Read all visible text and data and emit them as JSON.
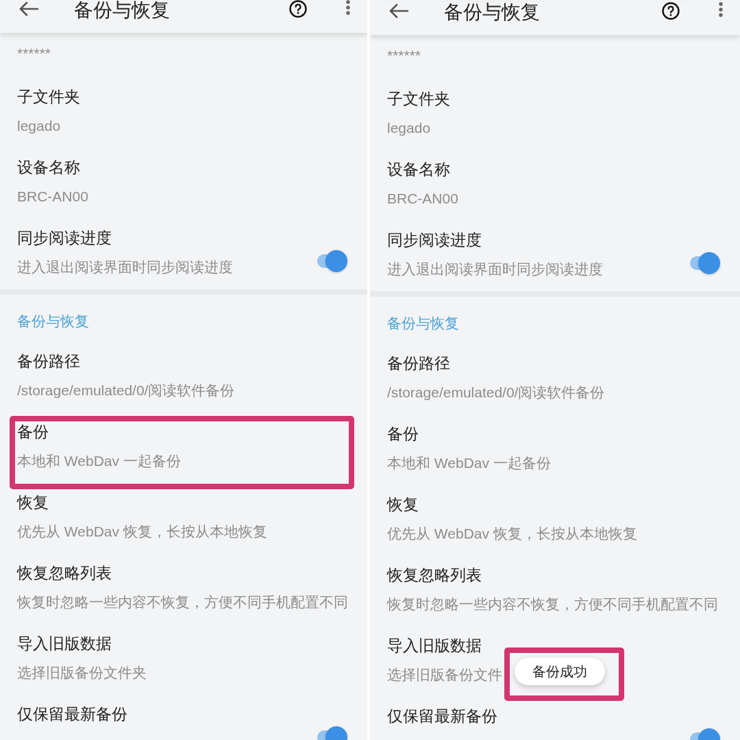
{
  "panels": [
    {
      "app_bar": {
        "title": "备份与恢复"
      },
      "items": [
        {
          "kind": "value",
          "summary": "******",
          "highlighted": false
        },
        {
          "kind": "pref",
          "title": "子文件夹",
          "summary": "legado",
          "highlighted": false
        },
        {
          "kind": "pref",
          "title": "设备名称",
          "summary": "BRC-AN00",
          "highlighted": false
        },
        {
          "kind": "switch",
          "title": "同步阅读进度",
          "summary": "进入退出阅读界面时同步阅读进度",
          "on": true,
          "highlighted": false
        },
        {
          "kind": "section",
          "title": "备份与恢复",
          "highlighted": false
        },
        {
          "kind": "pref",
          "title": "备份路径",
          "summary": "/storage/emulated/0/阅读软件备份",
          "highlighted": false
        },
        {
          "kind": "pref",
          "title": "备份",
          "summary": "本地和 WebDav 一起备份",
          "highlighted": true
        },
        {
          "kind": "pref",
          "title": "恢复",
          "summary": "优先从 WebDav 恢复，长按从本地恢复",
          "highlighted": false
        },
        {
          "kind": "pref",
          "title": "恢复忽略列表",
          "summary": "恢复时忽略一些内容不恢复，方便不同手机配置不同",
          "highlighted": false
        },
        {
          "kind": "pref",
          "title": "导入旧版数据",
          "summary": "选择旧版备份文件夹",
          "highlighted": false
        },
        {
          "kind": "switch",
          "title": "仅保留最新备份",
          "on": true,
          "highlighted": false
        }
      ]
    },
    {
      "app_bar": {
        "title": "备份与恢复"
      },
      "items": [
        {
          "kind": "value",
          "summary": "******",
          "highlighted": false
        },
        {
          "kind": "pref",
          "title": "子文件夹",
          "summary": "legado",
          "highlighted": false
        },
        {
          "kind": "pref",
          "title": "设备名称",
          "summary": "BRC-AN00",
          "highlighted": false
        },
        {
          "kind": "switch",
          "title": "同步阅读进度",
          "summary": "进入退出阅读界面时同步阅读进度",
          "on": true,
          "highlighted": false
        },
        {
          "kind": "section",
          "title": "备份与恢复",
          "highlighted": false
        },
        {
          "kind": "pref",
          "title": "备份路径",
          "summary": "/storage/emulated/0/阅读软件备份",
          "highlighted": false
        },
        {
          "kind": "pref",
          "title": "备份",
          "summary": "本地和 WebDav 一起备份",
          "highlighted": false
        },
        {
          "kind": "pref",
          "title": "恢复",
          "summary": "优先从 WebDav 恢复，长按从本地恢复",
          "highlighted": false
        },
        {
          "kind": "pref",
          "title": "恢复忽略列表",
          "summary": "恢复时忽略一些内容不恢复，方便不同手机配置不同",
          "highlighted": false
        },
        {
          "kind": "pref",
          "title": "导入旧版数据",
          "summary": "选择旧版备份文件",
          "highlighted": false
        },
        {
          "kind": "switch",
          "title": "仅保留最新备份",
          "on": true,
          "highlighted": false
        }
      ],
      "toast": {
        "text": "备份成功",
        "highlighted": true
      }
    }
  ]
}
